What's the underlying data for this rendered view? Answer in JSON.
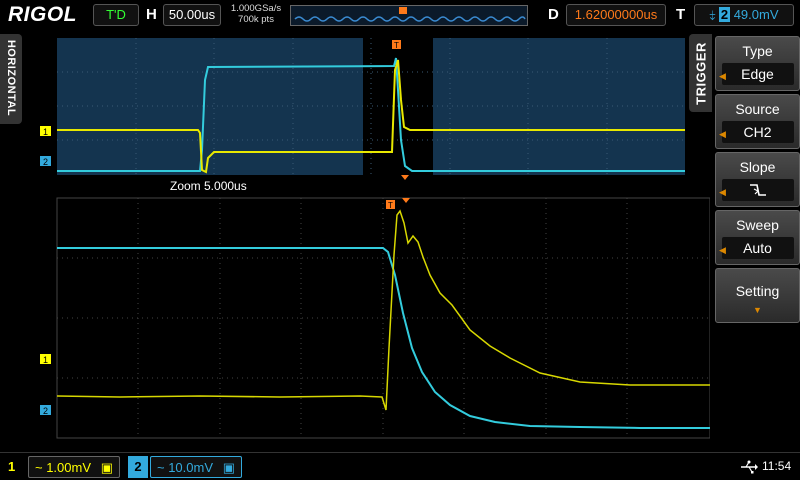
{
  "header": {
    "logo": "RIGOL",
    "run_state": "T'D",
    "timebase_label": "H",
    "timebase": "50.00us",
    "sample_rate": "1.000GSa/s",
    "memory_depth": "700k pts",
    "delay_label": "D",
    "delay": "1.62000000us",
    "trigger_label": "T",
    "trigger_source_num": "2",
    "trigger_level": "49.0mV"
  },
  "side_tab": {
    "label": "HORIZONTAL"
  },
  "screen": {
    "zoom_label": "Zoom  5.000us",
    "ch1_marker": "1",
    "ch2_marker": "2",
    "trigger_marker": "T"
  },
  "menu": {
    "title": "TRIGGER",
    "items": [
      {
        "title": "Type",
        "value": "Edge"
      },
      {
        "title": "Source",
        "value": "CH2"
      },
      {
        "title": "Slope",
        "value": "falling-edge"
      },
      {
        "title": "Sweep",
        "value": "Auto"
      },
      {
        "title": "Setting"
      }
    ]
  },
  "footer": {
    "ch1_num": "1",
    "ch1_scale": "~ 1.00mV",
    "ch2_num": "2",
    "ch2_scale": "~ 10.0mV",
    "time": "11:54"
  },
  "colors": {
    "ch1": "#ffff00",
    "ch2": "#33ccdd",
    "trigger": "#ff7a1a",
    "main_bg": "#14344f"
  }
}
